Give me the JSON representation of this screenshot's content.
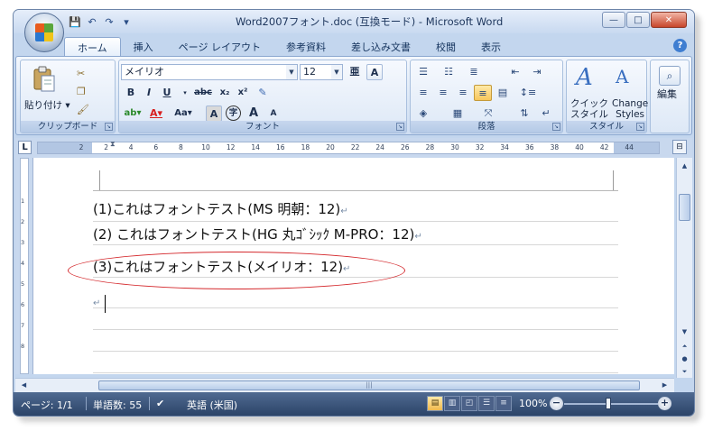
{
  "window": {
    "title": "Word2007フォント.doc (互換モード) - Microsoft Word",
    "minimize": "—",
    "maximize": "□",
    "close": "✕"
  },
  "qat": [
    "💾",
    "↶",
    "↷",
    "▾"
  ],
  "tabs": [
    {
      "label": "ホーム",
      "active": true
    },
    {
      "label": "挿入"
    },
    {
      "label": "ページ レイアウト"
    },
    {
      "label": "参考資料"
    },
    {
      "label": "差し込み文書"
    },
    {
      "label": "校閲"
    },
    {
      "label": "表示"
    }
  ],
  "ribbon": {
    "clipboard": {
      "label": "クリップボード",
      "paste": "貼り付け"
    },
    "font": {
      "label": "フォント",
      "font_name": "メイリオ",
      "font_size": "12",
      "bold": "B",
      "italic": "I",
      "underline": "U",
      "strike": "abc",
      "sub": "x₂",
      "sup": "x²",
      "grow": "A",
      "shrink": "A",
      "phonetic": "亜",
      "border": "A",
      "case": "Aa",
      "shade": "A",
      "enclose": "字"
    },
    "paragraph": {
      "label": "段落"
    },
    "styles": {
      "label": "スタイル",
      "quick": "クイック\nスタイル",
      "change": "Change\nStyles"
    },
    "editing": {
      "label": "編集"
    }
  },
  "ruler": {
    "ticks": [
      "2",
      "2",
      "4",
      "6",
      "8",
      "10",
      "12",
      "14",
      "16",
      "18",
      "20",
      "22",
      "24",
      "26",
      "28",
      "30",
      "32",
      "34",
      "36",
      "38",
      "40",
      "42",
      "44"
    ]
  },
  "vruler": {
    "ticks": [
      "1",
      "2",
      "3",
      "4",
      "5",
      "6",
      "7",
      "8"
    ]
  },
  "document": {
    "lines": [
      "(1)これはフォントテスト(MS 明朝：12)",
      "(2) これはフォントテスト(HG 丸ｺﾞｼｯｸ M-PRO：12)",
      "(3)これはフォントテスト(メイリオ：12)"
    ],
    "para_mark": "↵"
  },
  "status": {
    "page": "ページ: 1/1",
    "words": "単語数: 55",
    "language": "英語 (米国)",
    "zoom": "100%"
  },
  "colors": {
    "annotation": "#d4282c",
    "status_bar": "#2c4468"
  }
}
